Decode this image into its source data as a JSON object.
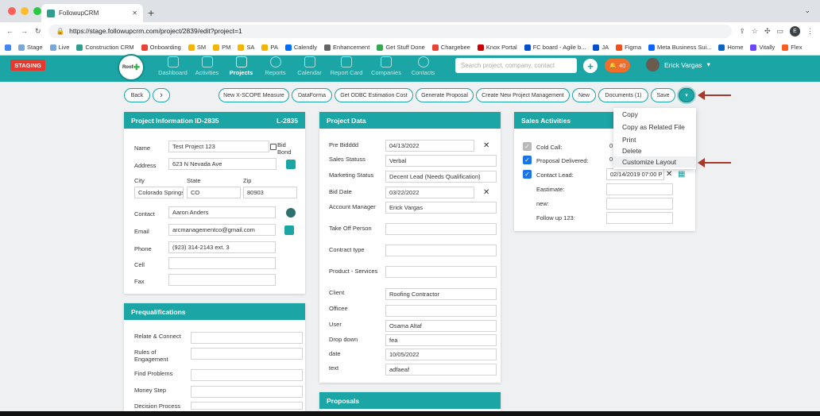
{
  "browser": {
    "tab_title": "FollowupCRM",
    "url": "https://stage.followupcrm.com/project/2839/edit?project=1",
    "profile_initial": "E",
    "bookmarks": [
      "Stage",
      "Live",
      "Construction CRM",
      "Onboarding",
      "SM",
      "PM",
      "SA",
      "PA",
      "Calendly",
      "Enhancement",
      "Get Stuff Done",
      "Chargebee",
      "Knox Portal",
      "FC board - Agile b...",
      "JA",
      "Figma",
      "Meta Business Sui...",
      "Home",
      "Vitally",
      "Flex"
    ]
  },
  "app": {
    "env_badge": "STAGING",
    "logo_text": "Roof",
    "nav": [
      "Dashboard",
      "Activities",
      "Projects",
      "Reports",
      "Calendar",
      "Report Card",
      "Companies",
      "Contacts"
    ],
    "search_placeholder": "Search project, company, contact",
    "notif_count": "40",
    "user_name": "Erick Vargas"
  },
  "toolbar": {
    "back": "Back",
    "next": "›",
    "buttons": [
      "New X-SCOPE Measure",
      "DataForma",
      "Get ODBC Estimation Cost",
      "Generate Proposal",
      "Create New Project Management",
      "New",
      "Documents (1)",
      "Save"
    ],
    "dropdown": "▾"
  },
  "project_info": {
    "title": "Project Information ID-2835",
    "code": "L-2835",
    "name_label": "Name",
    "name": "Test Project 123",
    "bid_bond": "Bid Bond",
    "address_label": "Address",
    "address": "623 N Nevada Ave",
    "city_label": "City",
    "city": "Colorado Springs",
    "state_label": "State",
    "state": "CO",
    "zip_label": "Zip",
    "zip": "80903",
    "contact_label": "Contact",
    "contact": "Aaron Anders",
    "email_label": "Email",
    "email": "arcmanagementco@gmail.com",
    "phone_label": "Phone",
    "phone": "(923) 314-2143 ext. 3",
    "cell_label": "Cell",
    "fax_label": "Fax"
  },
  "prequal": {
    "title": "Prequalifications",
    "fields": [
      "Relate & Connect",
      "Rules of Engagement",
      "Find Problems",
      "Money Step",
      "Decision Process"
    ]
  },
  "project_data": {
    "title": "Project Data",
    "fields": [
      {
        "label": "Pre Bidddd",
        "value": "04/13/2022"
      },
      {
        "label": "Sales Statuss",
        "value": "Verbal"
      },
      {
        "label": "Marketing Status",
        "value": "Decent Lead (Needs Qualification)"
      },
      {
        "label": "Bid Date",
        "value": "03/22/2022"
      },
      {
        "label": "Account Manager",
        "value": "Erick Vargas"
      },
      {
        "label": "Take Off Person",
        "value": ""
      },
      {
        "label": "Contract type",
        "value": ""
      },
      {
        "label": "Product - Services",
        "value": ""
      },
      {
        "label": "Client",
        "value": "Roofing Contractor"
      },
      {
        "label": "Officee",
        "value": ""
      },
      {
        "label": "User",
        "value": "Osama Altaf"
      },
      {
        "label": "Drop down",
        "value": "fea"
      },
      {
        "label": "date",
        "value": "10/05/2022"
      },
      {
        "label": "text",
        "value": "adfaeaf"
      }
    ]
  },
  "proposals": {
    "title": "Proposals"
  },
  "sales": {
    "title": "Sales Activities",
    "rows": [
      {
        "label": "Cold Call:",
        "value": "0"
      },
      {
        "label": "Proposal Delivered:",
        "value": "0"
      },
      {
        "label": "Contact Lead:",
        "value": "02/14/2019 07:00 P"
      },
      {
        "label": "Eastimate:",
        "value": ""
      },
      {
        "label": "new:",
        "value": ""
      },
      {
        "label": "Follow up 123:",
        "value": ""
      }
    ]
  },
  "menu": {
    "items": [
      "Copy",
      "Copy as Related File",
      "Print",
      "Delete",
      "Customize Layout"
    ]
  }
}
